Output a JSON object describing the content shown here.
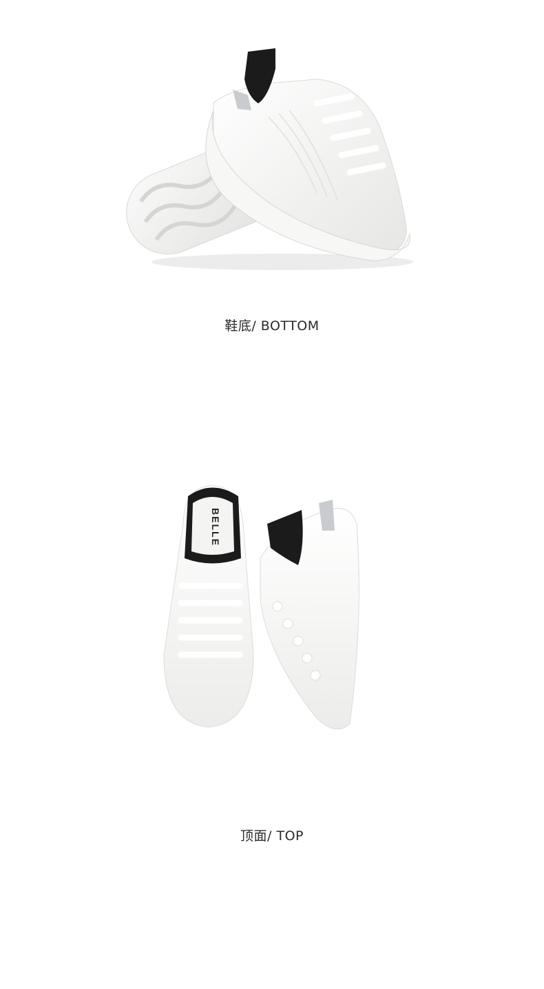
{
  "sections": [
    {
      "caption": "鞋底/ BOTTOM",
      "image": "white-sneaker-sole-view"
    },
    {
      "caption": "顶面/ TOP",
      "image": "white-sneaker-top-view",
      "brand_on_insole": "BELLE"
    }
  ],
  "colors": {
    "background": "#ffffff",
    "caption_text": "#2a2a2a",
    "shoe_white": "#f4f4f2",
    "heel_black": "#1b1b1b"
  }
}
